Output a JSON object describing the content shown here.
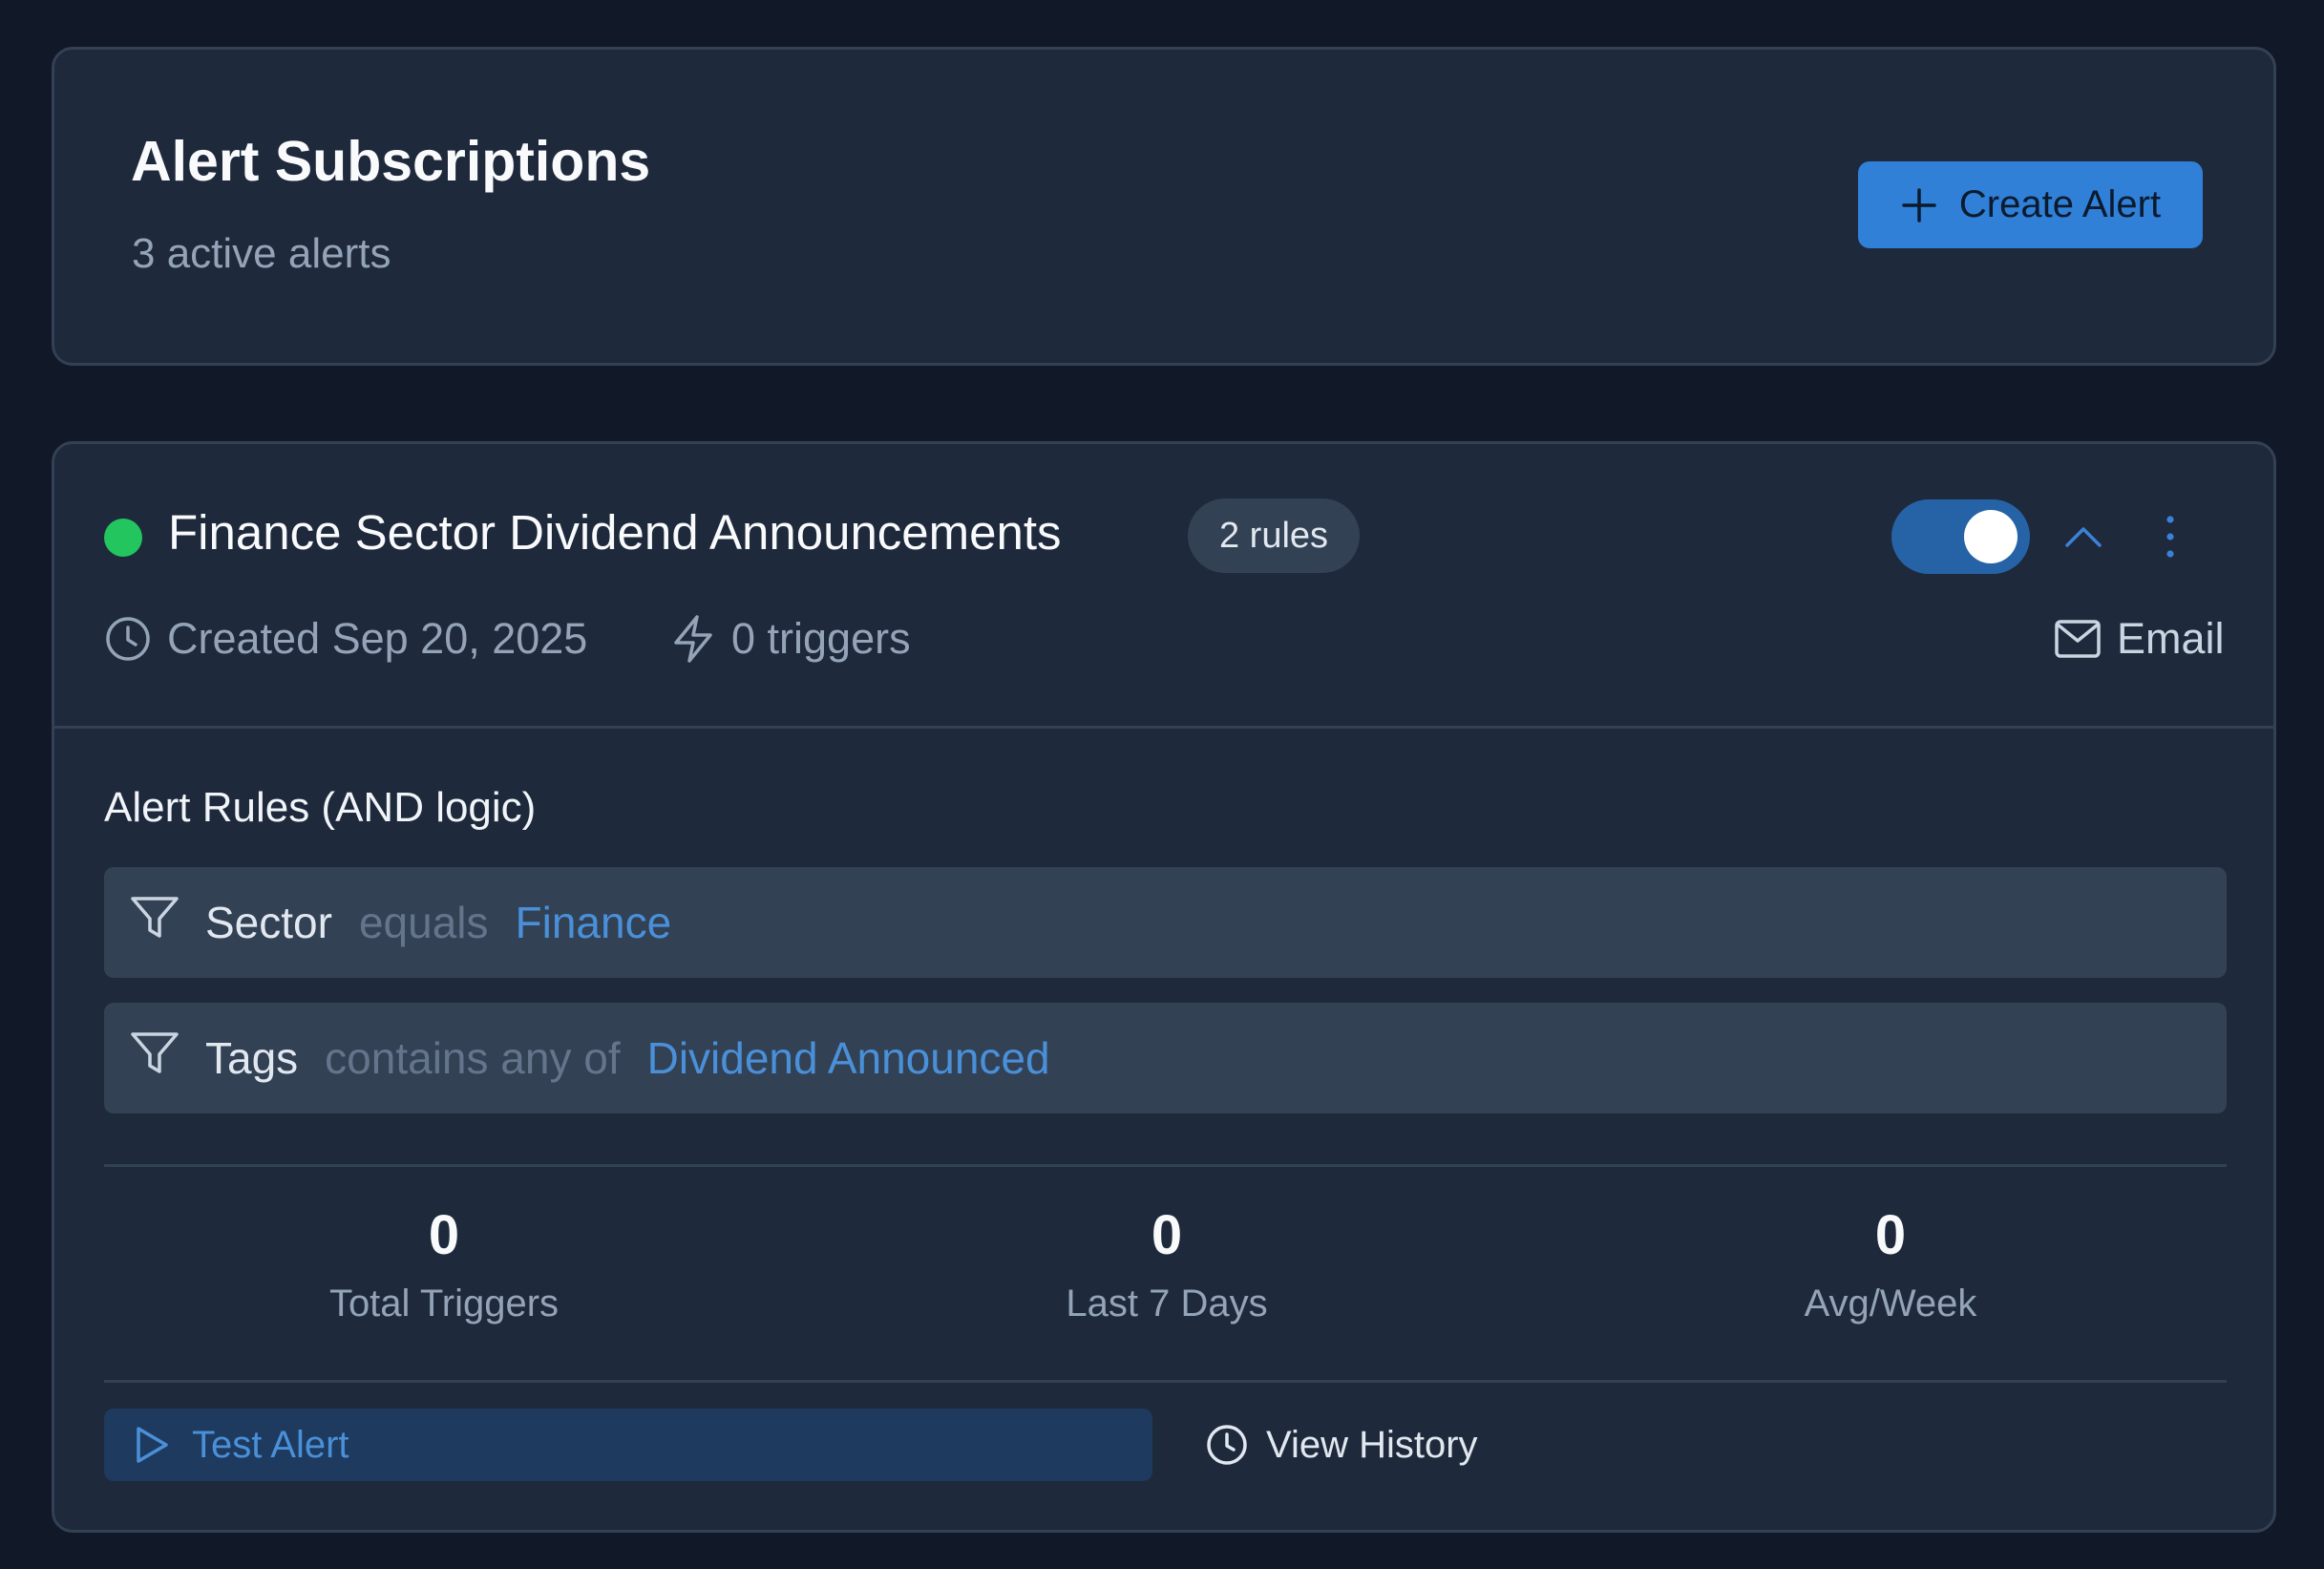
{
  "header": {
    "title": "Alert Subscriptions",
    "subtitle": "3 active alerts",
    "create_button_label": "Create Alert"
  },
  "alert": {
    "status": "active",
    "status_color": "#22c55e",
    "name": "Finance Sector Dividend Announcements",
    "rules_badge": "2 rules",
    "enabled": true,
    "created": "Created Sep 20, 2025",
    "triggers": "0 triggers",
    "channel": "Email",
    "rules_section_title": "Alert Rules (AND logic)",
    "rules": [
      {
        "field": "Sector",
        "operator": "equals",
        "value": "Finance"
      },
      {
        "field": "Tags",
        "operator": "contains any of",
        "value": "Dividend Announced"
      }
    ],
    "stats": [
      {
        "value": "0",
        "label": "Total Triggers"
      },
      {
        "value": "0",
        "label": "Last 7 Days"
      },
      {
        "value": "0",
        "label": "Avg/Week"
      }
    ],
    "test_button_label": "Test Alert",
    "history_button_label": "View History"
  },
  "colors": {
    "accent": "#2f80d6",
    "link": "#4a90d9",
    "background": "#111827",
    "card": "#1e293b"
  },
  "icons": {
    "create": "plus-icon",
    "created": "clock-icon",
    "triggers": "lightning-icon",
    "channel": "mail-icon",
    "rule": "filter-icon",
    "collapse": "chevron-up-icon",
    "more": "more-vertical-icon",
    "test": "play-icon",
    "history": "clock-icon"
  }
}
